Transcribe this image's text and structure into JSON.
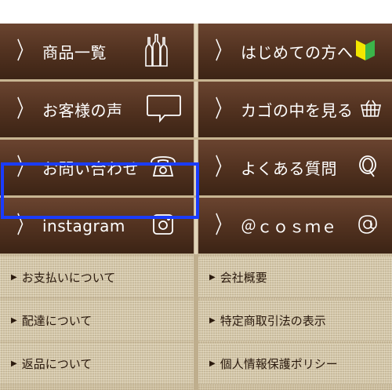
{
  "main_menu": [
    {
      "label": "商品一覧",
      "icon": "bottles-icon"
    },
    {
      "label": "はじめての方へ",
      "icon": "beginner-mark-icon"
    },
    {
      "label": "お客様の声",
      "icon": "speech-bubble-icon"
    },
    {
      "label": "カゴの中を見る",
      "icon": "basket-icon"
    },
    {
      "label": "お問い合わせ",
      "icon": "telephone-icon"
    },
    {
      "label": "よくある質問",
      "icon": "q-icon"
    },
    {
      "label": "instagram",
      "icon": "instagram-icon"
    },
    {
      "label": "＠ｃｏｓｍｅ",
      "icon": "at-icon"
    }
  ],
  "chevron": "〉",
  "sub_menu": [
    {
      "label": "お支払いについて"
    },
    {
      "label": "会社概要"
    },
    {
      "label": "配達について"
    },
    {
      "label": "特定商取引法の表示"
    },
    {
      "label": "返品について"
    },
    {
      "label": "個人情報保護ポリシー"
    }
  ],
  "triangle": "▶",
  "colors": {
    "tile_brown": "#523220",
    "highlight_blue": "#1a3cff",
    "beginner_green": "#3bb54a",
    "beginner_yellow": "#f3e600"
  }
}
